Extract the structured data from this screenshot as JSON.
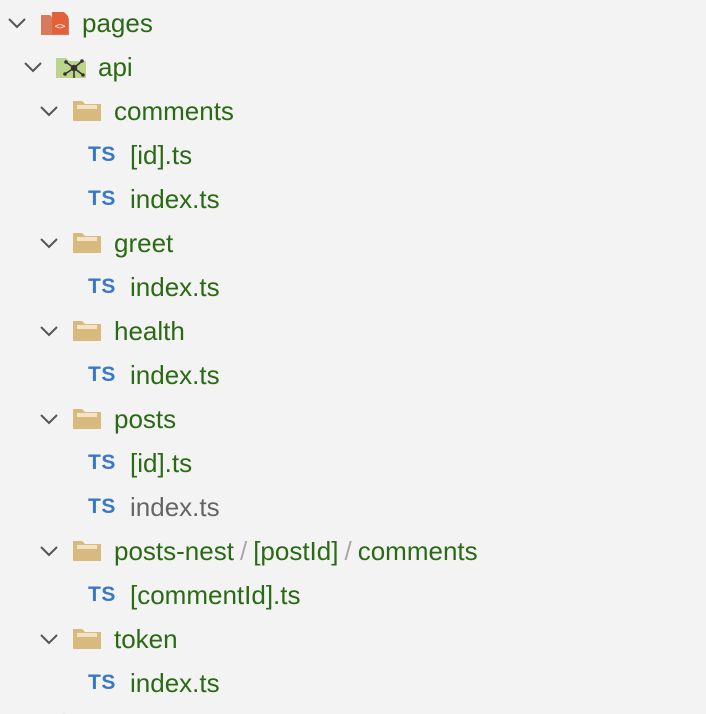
{
  "tree": {
    "root": {
      "label": "pages",
      "icon": "pages-folder-icon",
      "expanded": true
    },
    "api": {
      "label": "api",
      "icon": "api-folder-icon",
      "expanded": true
    },
    "folders": [
      {
        "label": "comments",
        "files": [
          "[id].ts",
          "index.ts"
        ]
      },
      {
        "label": "greet",
        "files": [
          "index.ts"
        ]
      },
      {
        "label": "health",
        "files": [
          "index.ts"
        ]
      },
      {
        "label": "posts",
        "files": [
          "[id].ts",
          "index.ts"
        ]
      },
      {
        "label_parts": [
          "posts-nest",
          "[postId]",
          "comments"
        ],
        "files": [
          "[commentId].ts"
        ]
      },
      {
        "label": "token",
        "files": [
          "index.ts"
        ]
      }
    ],
    "ts_badge": "TS",
    "separator": "/"
  },
  "colors": {
    "background": "#f3f3f3",
    "label": "#2b6a14",
    "muted_label": "#666666",
    "ts_badge": "#3a78c5",
    "folder": "#d8b97e",
    "separator": "#a8a8a8"
  }
}
